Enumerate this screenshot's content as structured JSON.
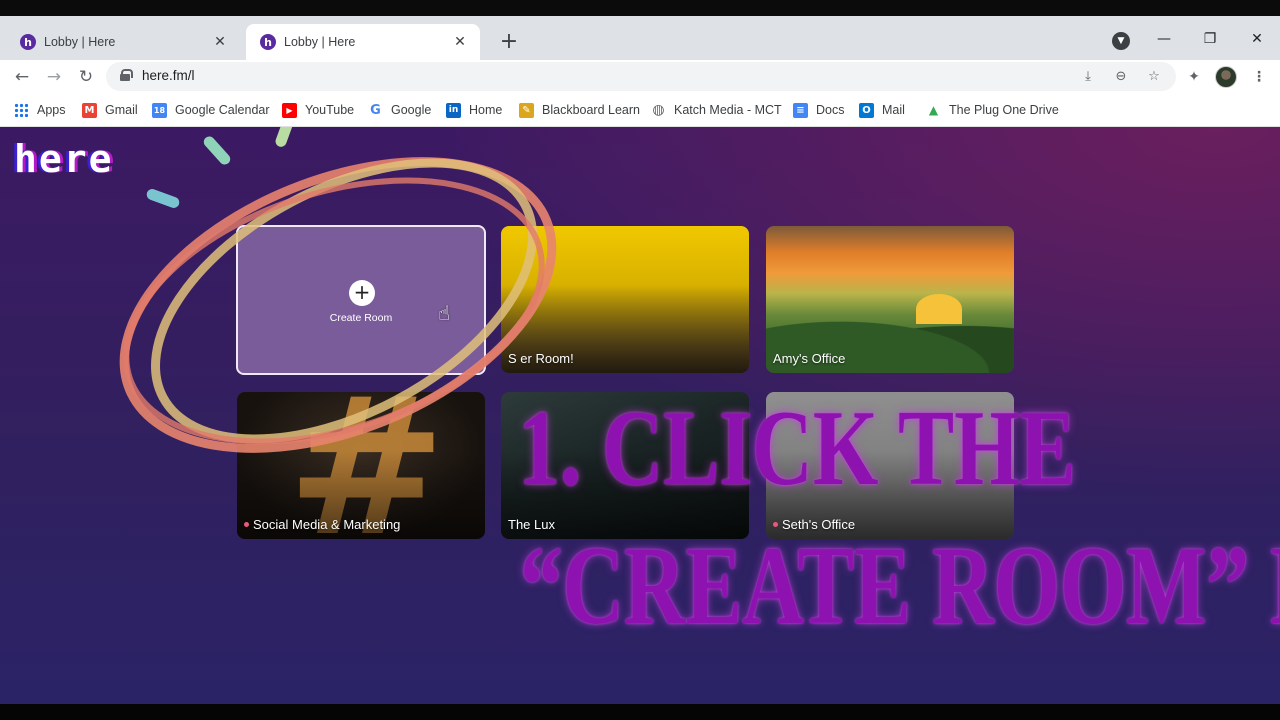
{
  "browser": {
    "tabs": [
      {
        "title": "Lobby | Here",
        "favicon": "h",
        "active": false
      },
      {
        "title": "Lobby | Here",
        "favicon": "h",
        "active": true
      }
    ],
    "close_glyph": "✕",
    "new_tab_glyph": "+",
    "window_controls": {
      "minimize": "—",
      "maximize": "❐",
      "close": "✕"
    },
    "url": "here.fm/l",
    "nav": {
      "back": "←",
      "forward": "→",
      "reload": "↻"
    },
    "omnibox_icons": {
      "install": "⤓",
      "zoom": "⊖",
      "bookmark": "☆"
    },
    "toolbar_icons": {
      "extensions": "✦",
      "menu": "⋮"
    },
    "bookmarks": [
      {
        "label": "Apps",
        "icon": "apps-grid-icon"
      },
      {
        "label": "Gmail",
        "icon": "gmail-icon",
        "glyph": "M",
        "color": "#ea4335"
      },
      {
        "label": "Google Calendar",
        "icon": "calendar-icon",
        "glyph": "18",
        "color": "#4285f4"
      },
      {
        "label": "YouTube",
        "icon": "youtube-icon",
        "glyph": "▶",
        "color": "#ff0000"
      },
      {
        "label": "Google",
        "icon": "google-icon",
        "glyph": "G",
        "color": "#4285f4"
      },
      {
        "label": "Home",
        "icon": "linkedin-icon",
        "glyph": "in",
        "color": "#0a66c2"
      },
      {
        "label": "Blackboard Learn",
        "icon": "blackboard-icon",
        "glyph": "✎",
        "color": "#d9a61e"
      },
      {
        "label": "Katch Media - MCT",
        "icon": "globe-icon",
        "glyph": "◍",
        "color": "#5f6368"
      },
      {
        "label": "Docs",
        "icon": "docs-icon",
        "glyph": "≡",
        "color": "#4285f4"
      },
      {
        "label": "Mail",
        "icon": "outlook-icon",
        "glyph": "O",
        "color": "#0078d4"
      },
      {
        "label": "The Plug One Drive",
        "icon": "drive-icon",
        "glyph": "▲",
        "color": "#34a853"
      }
    ]
  },
  "app": {
    "logo": "here",
    "create_room": {
      "icon": "+",
      "label": "Create Room"
    },
    "rooms": [
      {
        "label": "S    er Room!",
        "live": false
      },
      {
        "label": "Amy's Office",
        "live": false
      },
      {
        "label": "Social Media & Marketing",
        "live": true
      },
      {
        "label": "The Lux",
        "live": false
      },
      {
        "label": "Seth's Office",
        "live": true
      }
    ]
  },
  "overlay": {
    "line1": "1. CLICK THE",
    "line2": "“CREATE ROOM” BOX",
    "color": "#8e12b0"
  }
}
